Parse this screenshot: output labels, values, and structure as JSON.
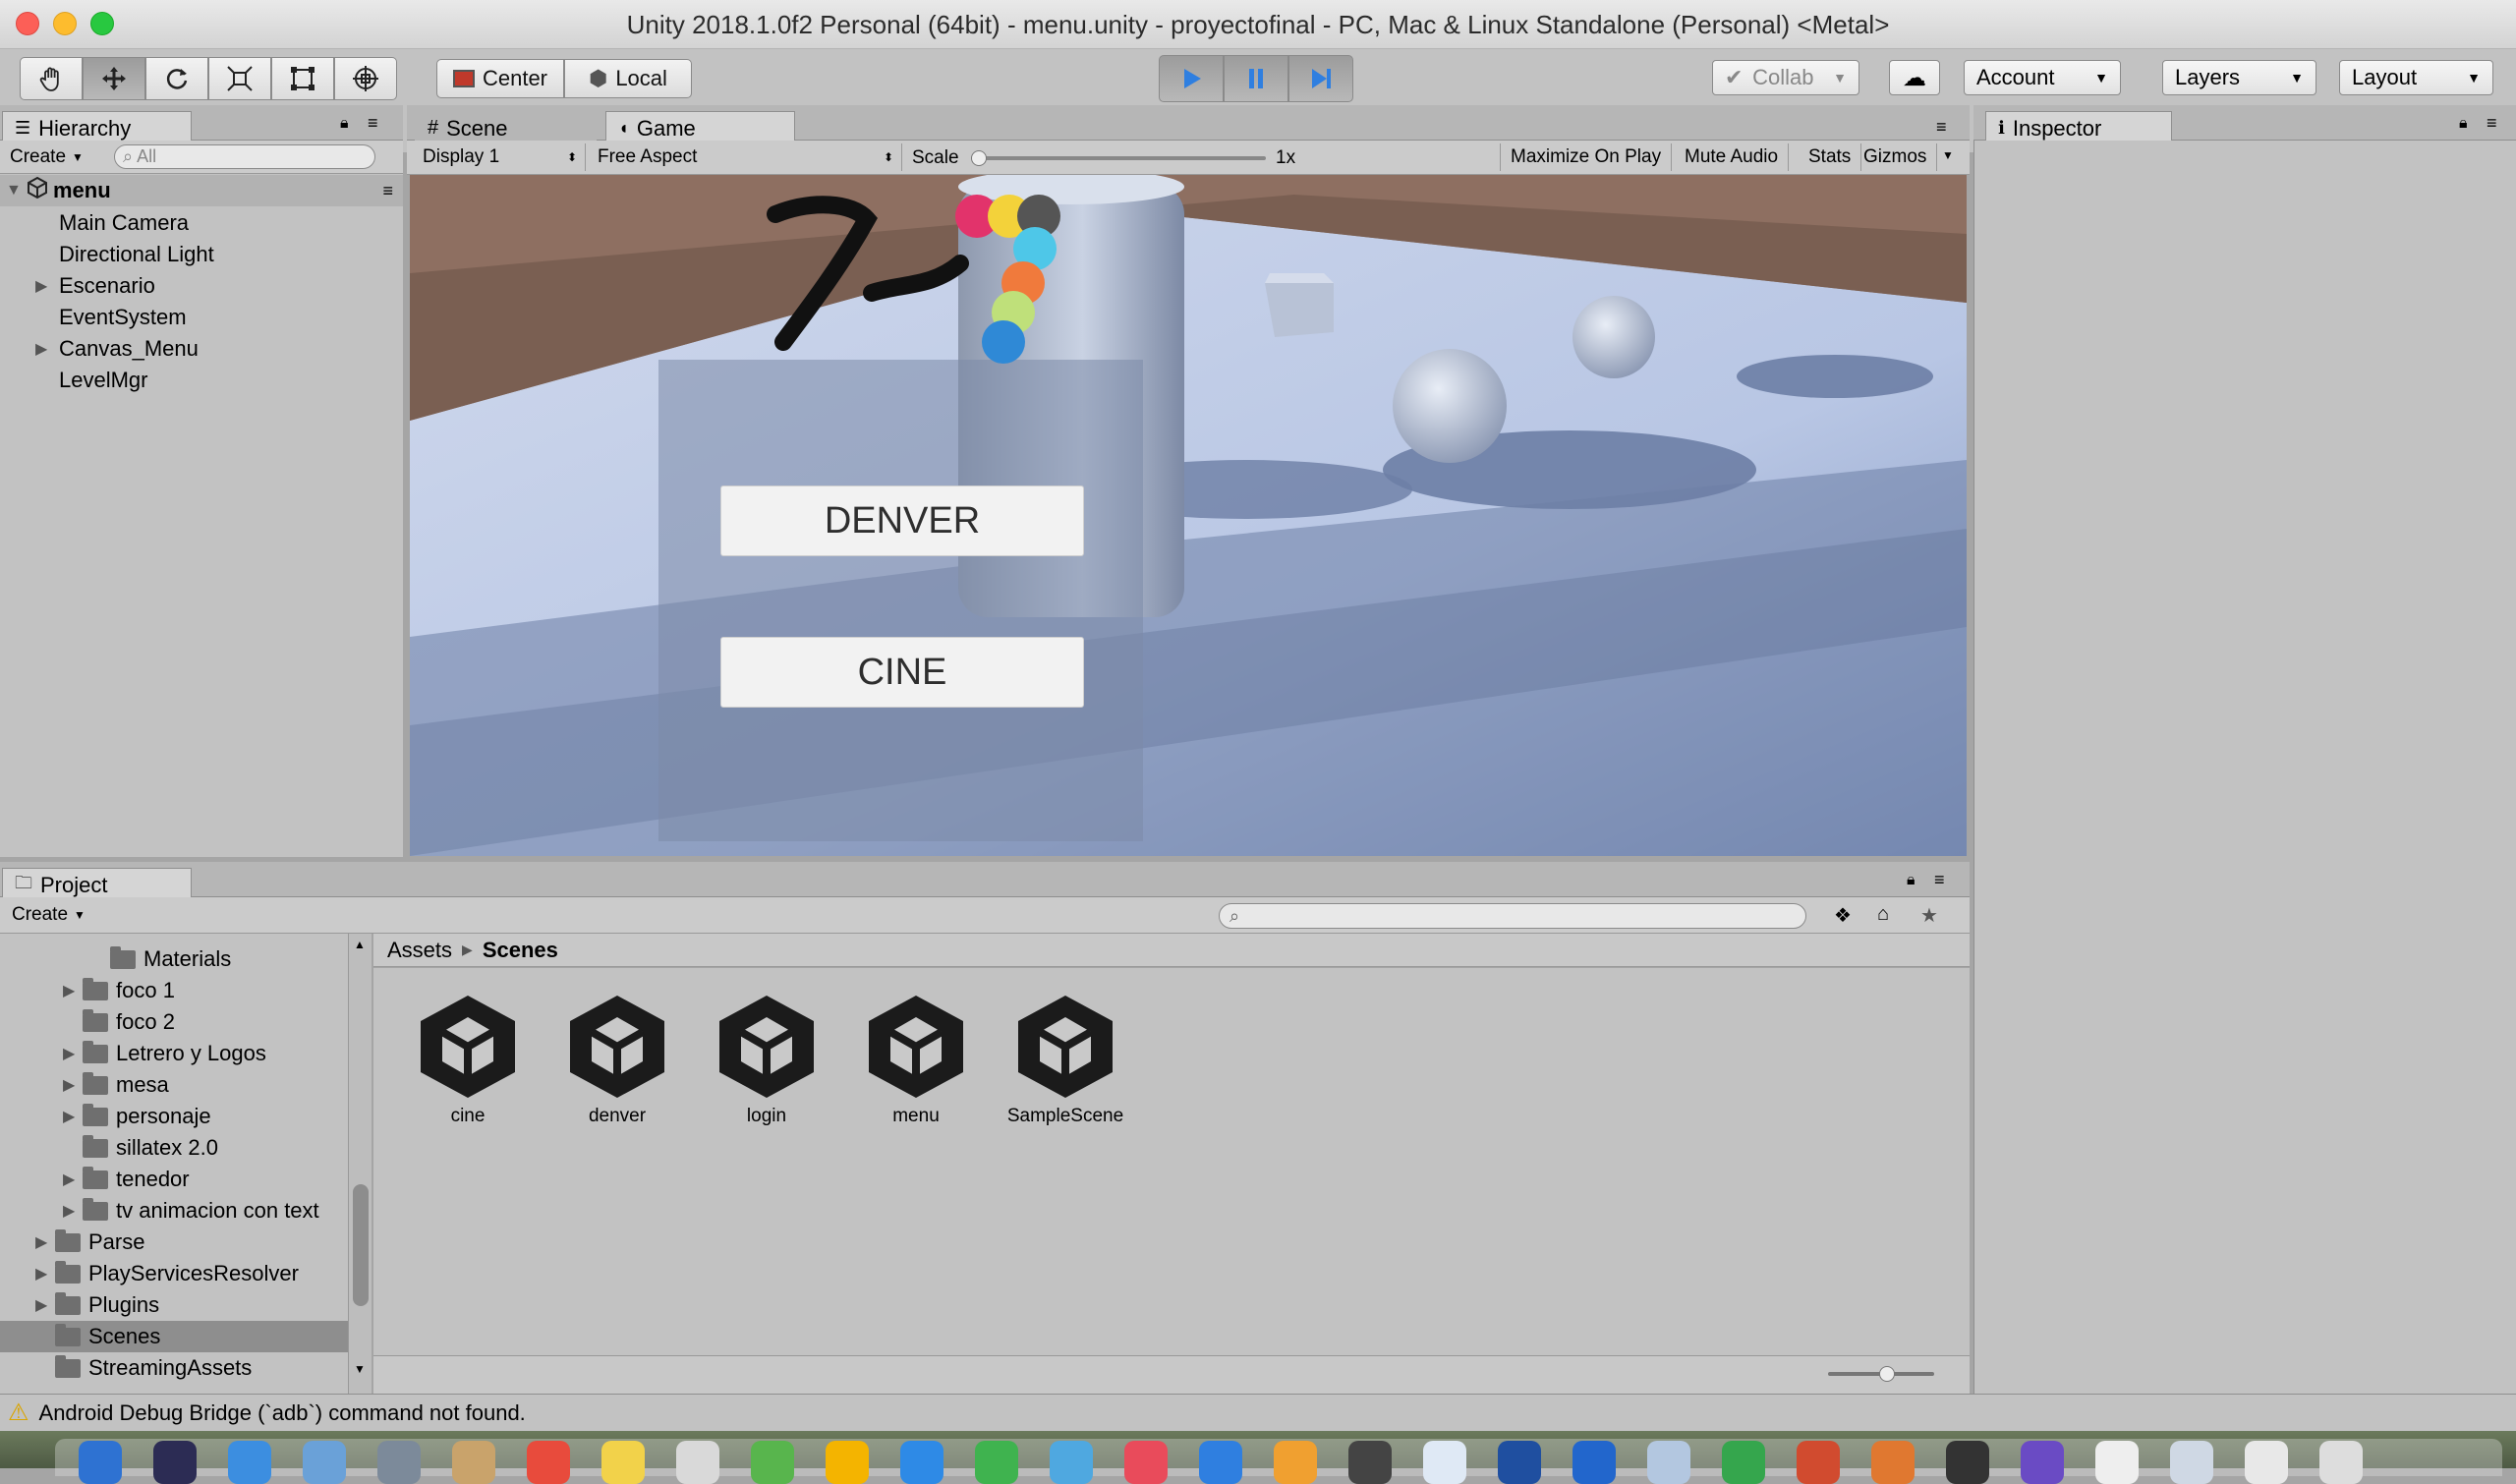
{
  "window": {
    "title": "Unity 2018.1.0f2 Personal (64bit) - menu.unity - proyectofinal - PC, Mac & Linux Standalone (Personal) <Metal>"
  },
  "toolbar": {
    "pivot_label": "Center",
    "space_label": "Local",
    "collab_label": "Collab",
    "account_label": "Account",
    "layers_label": "Layers",
    "layout_label": "Layout"
  },
  "hierarchy": {
    "tab_label": "Hierarchy",
    "create_label": "Create",
    "search_placeholder": "All",
    "scene_name": "menu",
    "items": [
      {
        "label": "Main Camera",
        "expandable": false
      },
      {
        "label": "Directional Light",
        "expandable": false
      },
      {
        "label": "Escenario",
        "expandable": true
      },
      {
        "label": "EventSystem",
        "expandable": false
      },
      {
        "label": "Canvas_Menu",
        "expandable": true
      },
      {
        "label": "LevelMgr",
        "expandable": false
      }
    ]
  },
  "center_tabs": {
    "scene_label": "Scene",
    "game_label": "Game"
  },
  "game_toolbar": {
    "display": "Display 1",
    "aspect": "Free Aspect",
    "scale_label": "Scale",
    "scale_value": "1x",
    "scale_fraction": 0.0,
    "maximize_label": "Maximize On Play",
    "mute_label": "Mute Audio",
    "stats_label": "Stats",
    "gizmos_label": "Gizmos"
  },
  "game_view": {
    "buttons": [
      "DENVER",
      "CINE"
    ]
  },
  "inspector": {
    "tab_label": "Inspector"
  },
  "project": {
    "tab_label": "Project",
    "create_label": "Create",
    "tree": [
      {
        "label": "Materials",
        "indent": 2,
        "expandable": false,
        "selected": false
      },
      {
        "label": "foco 1",
        "indent": 1,
        "expandable": true,
        "selected": false
      },
      {
        "label": "foco 2",
        "indent": 1,
        "expandable": false,
        "selected": false
      },
      {
        "label": "Letrero y Logos",
        "indent": 1,
        "expandable": true,
        "selected": false
      },
      {
        "label": "mesa",
        "indent": 1,
        "expandable": true,
        "selected": false
      },
      {
        "label": "personaje",
        "indent": 1,
        "expandable": true,
        "selected": false
      },
      {
        "label": "sillatex 2.0",
        "indent": 1,
        "expandable": false,
        "selected": false
      },
      {
        "label": "tenedor",
        "indent": 1,
        "expandable": true,
        "selected": false
      },
      {
        "label": "tv animacion con text",
        "indent": 1,
        "expandable": true,
        "selected": false
      },
      {
        "label": "Parse",
        "indent": 0,
        "expandable": true,
        "selected": false
      },
      {
        "label": "PlayServicesResolver",
        "indent": 0,
        "expandable": true,
        "selected": false
      },
      {
        "label": "Plugins",
        "indent": 0,
        "expandable": true,
        "selected": false
      },
      {
        "label": "Scenes",
        "indent": 0,
        "expandable": false,
        "selected": true
      },
      {
        "label": "StreamingAssets",
        "indent": 0,
        "expandable": false,
        "selected": false
      }
    ],
    "breadcrumb": [
      "Assets",
      "Scenes"
    ],
    "assets": [
      "cine",
      "denver",
      "login",
      "menu",
      "SampleScene"
    ]
  },
  "status": {
    "message": "Android Debug Bridge (`adb`) command not found."
  },
  "colors": {
    "accent_play": "#2f7fe0",
    "selection": "#8e8e8e",
    "panel": "#c2c2c2"
  }
}
